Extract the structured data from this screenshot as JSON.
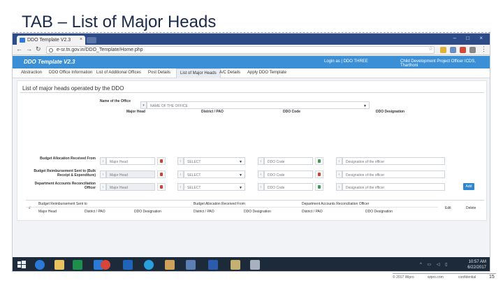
{
  "slide": {
    "title": "TAB – List of Major Heads",
    "footer_copyright": "© 2017 Wipro",
    "footer_site": "wipro.com",
    "footer_confidential": "confidential",
    "page_number": "15"
  },
  "browser": {
    "tab_title": "DDO Template V2.3",
    "url": "e-sr.tn.gov.in/DDO_Template/Home.php"
  },
  "app": {
    "logo": "DDO Template V2.3",
    "login_text": "Login as | DDO THREE",
    "role_text": "Child Development Project Officer ICDS, Tharthoni",
    "tabs": [
      "Abstraction",
      "DDO Office Information",
      "List of Additional Offices",
      "Post Details",
      "List of Major Heads",
      "A/C Details",
      "Apply DDO Template"
    ],
    "active_tab_index": 4
  },
  "form": {
    "section_title": "List of major heads operated by the DDO",
    "office_label": "Name of the Office",
    "office_value": "NAME OF THE OFFICE",
    "col_major_head": "Major Head",
    "col_district": "District / PAO",
    "col_ddo_code": "DDO Code",
    "col_ddo_designation": "DDO Designation",
    "rows": [
      {
        "label": "Budget Allocation Received From",
        "major_head_placeholder": "Major Head",
        "district_value": "SELECT",
        "ddo_code_placeholder": "DDO Code",
        "designation_placeholder": "Designation of the officer",
        "major_head_disabled": false
      },
      {
        "label": "Budget Reimbursement Sent to (Bulk Receipt & Expenditure)",
        "major_head_placeholder": "Major Head",
        "district_value": "SELECT",
        "ddo_code_placeholder": "DDO Code",
        "designation_placeholder": "Designation of the officer",
        "major_head_disabled": true
      },
      {
        "label": "Department Accounts Reconciliation Officer",
        "major_head_placeholder": "Major Head",
        "district_value": "SELECT",
        "ddo_code_placeholder": "DDO Code",
        "designation_placeholder": "Designation of the officer",
        "major_head_disabled": true
      }
    ],
    "add_label": "Add"
  },
  "table": {
    "index_header": "#",
    "group_headers": [
      "Budget Reimbursement Sent to",
      "Budget Allocation Received From",
      "Department Accounts Reconciliation Officer"
    ],
    "sub_headers": [
      "Major Head",
      "District / PAO",
      "DDO Designation",
      "District / PAO",
      "DDO Designation",
      "District / PAO",
      "DDO Designation"
    ],
    "edit_header": "Edit",
    "delete_header": "Delete"
  },
  "taskbar": {
    "time": "10:57 AM",
    "date": "6/22/2017",
    "icons": [
      "windows-start",
      "internet-explorer",
      "file-explorer",
      "store",
      "chrome",
      "outlook",
      "skype",
      "paint",
      "photos",
      "word",
      "misc-app",
      "misc-app-2"
    ]
  },
  "colors": {
    "title": "#1a2a4a",
    "browser_tabstrip": "#2d4b86",
    "app_header": "#3a8fd6",
    "taskbar": "#1c2a3a",
    "add_button": "#2f86d0"
  }
}
